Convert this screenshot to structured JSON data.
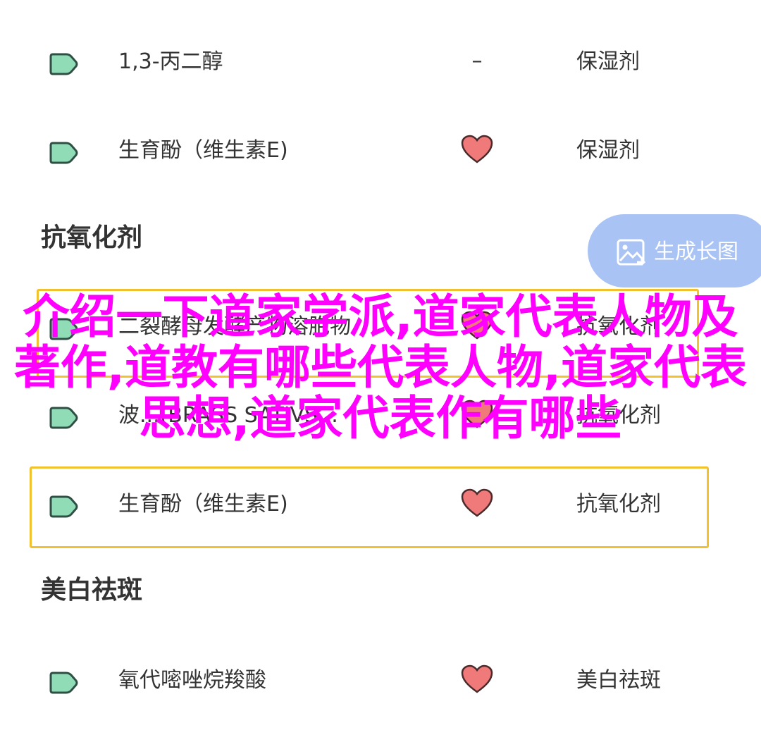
{
  "rows": [
    {
      "name": "1,3-丙二醇",
      "safety": "–",
      "function": "保湿剂"
    },
    {
      "name": "生育酚（维生素E)",
      "safety": "heart-icon",
      "function": "保湿剂"
    },
    {
      "name": "二裂酵母发酵产物溶胞物",
      "safety": "heart-icon",
      "function": "抗氧化剂"
    },
    {
      "name": "波...(BRASS SATIVS...",
      "safety": "heart-icon",
      "function": "抗氧化剂"
    },
    {
      "name": "生育酚（维生素E)",
      "safety": "heart-icon",
      "function": "抗氧化剂"
    },
    {
      "name": "氧代嘧唑烷羧酸",
      "safety": "heart-icon",
      "function": "美白祛斑"
    }
  ],
  "sections": {
    "antioxidant": "抗氧化剂",
    "whitening": "美白祛斑"
  },
  "generate_button": {
    "label": "生成长图",
    "icon": "image-export-icon"
  },
  "overlay_title": "介绍一下道家学派,道家代表人物及著作,道教有哪些代表人物,道家代表思想,道家代表作有哪些",
  "colors": {
    "tag_fill": "#8fdcb6",
    "tag_stroke": "#2f4f45",
    "heart_fill": "#f07a7a",
    "heart_stroke": "#4a2a2a",
    "highlight_border": "#f2c12e",
    "generate_bg": "#a9c3f5",
    "overlay_text": "#ff00ff"
  }
}
